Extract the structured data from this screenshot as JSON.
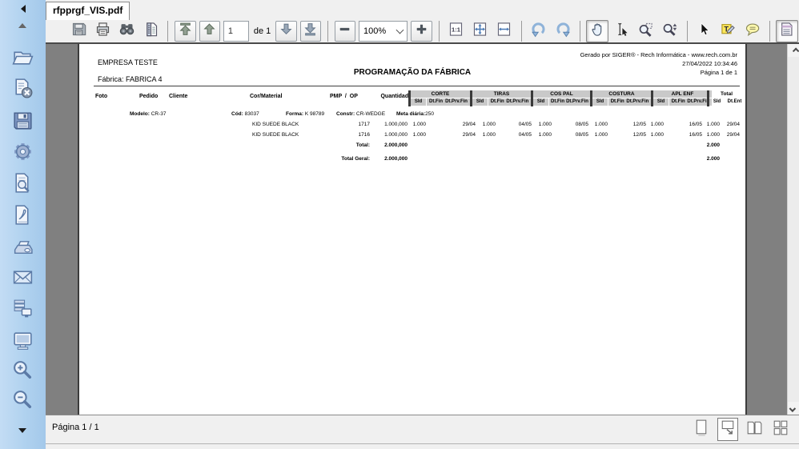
{
  "tab": {
    "title": "rfpprgf_VIS.pdf"
  },
  "toolbar": {
    "page_number": "1",
    "page_count_label": "de 1",
    "zoom_level": "100%",
    "actual_size_label": "1:1",
    "note_letter": "T"
  },
  "icons": {
    "sidebar": [
      "open-folder-icon",
      "close-document-icon",
      "save-icon",
      "settings-icon",
      "preview-icon",
      "pdf-icon",
      "print-icon",
      "email-icon",
      "export-icon",
      "monitor-icon",
      "zoom-in-icon",
      "zoom-out-icon"
    ],
    "toolbar": [
      "save-icon",
      "print-icon",
      "search-binoculars-icon",
      "report-icon",
      "first-page-icon",
      "prev-page-icon",
      "next-page-icon",
      "last-page-icon",
      "zoom-out-icon",
      "zoom-in-icon",
      "actual-size-icon",
      "fit-page-icon",
      "fit-width-icon",
      "rotate-left-icon",
      "rotate-right-icon",
      "hand-tool-icon",
      "select-text-icon",
      "zoom-marquee-icon",
      "zoom-dynamic-icon",
      "pointer-icon",
      "text-note-icon",
      "comment-icon",
      "pages-toggle-icon"
    ],
    "statusbar": [
      "single-page-icon",
      "fit-window-icon",
      "facing-pages-icon",
      "grid-pages-icon"
    ]
  },
  "report": {
    "company": "EMPRESA TESTE",
    "factory": "Fábrica: FABRICA 4",
    "title": "PROGRAMAÇÃO DA FÁBRICA",
    "generated_by": "Gerado por SIGER® - Rech Informática - www.rech.com.br",
    "generated_at": "27/04/2022 10:34:46",
    "page_info": "Página 1 de 1",
    "columns": {
      "foto": "Foto",
      "pedido": "Pedido",
      "cliente": "Cliente",
      "cor_material": "Cor/Material",
      "pmp_op": "PMP  /  OP",
      "quantidade": "Quantidade"
    },
    "groups": [
      {
        "name": "CORTE",
        "sld": "Sld",
        "fin": "Dt.Fin",
        "prv": "Dt.Prv.Fin"
      },
      {
        "name": "TIRAS",
        "sld": "Sld",
        "fin": "Dt.Fin",
        "prv": "Dt.Prv.Fin"
      },
      {
        "name": "COS PAL",
        "sld": "Sld",
        "fin": "Dt.Fin",
        "prv": "Dt.Prv.Fin"
      },
      {
        "name": "COSTURA",
        "sld": "Sld",
        "fin": "Dt.Fin",
        "prv": "Dt.Prv.Fin"
      },
      {
        "name": "APL ENF",
        "sld": "Sld",
        "fin": "Dt.Fin",
        "prv": "Dt.Prv.Fin"
      }
    ],
    "total_group": {
      "name": "Total",
      "sld": "Sld",
      "ent": "Dt.Ent"
    },
    "model": {
      "modelo_label": "Modelo:",
      "modelo": "CR-37",
      "cod_label": "Cód:",
      "cod": "83037",
      "forma_label": "Forma:",
      "forma": "K 98789",
      "constr_label": "Constr:",
      "constr": "CR-WEDGE",
      "meta_label": "Meta diária:",
      "meta": "250"
    },
    "rows": [
      {
        "cor": "KID SUEDE BLACK",
        "op": "1717",
        "qtd": "1.000,000",
        "corte_sld": "1.000",
        "corte_prv": "29/04",
        "tiras_sld": "1.000",
        "tiras_prv": "04/05",
        "cospal_sld": "1.000",
        "cospal_prv": "08/05",
        "costura_sld": "1.000",
        "costura_prv": "12/05",
        "aplenf_sld": "1.000",
        "aplenf_prv": "16/05",
        "total_sld": "1.000",
        "total_ent": "29/04"
      },
      {
        "cor": "KID SUEDE BLACK",
        "op": "1716",
        "qtd": "1.000,000",
        "corte_sld": "1.000",
        "corte_prv": "29/04",
        "tiras_sld": "1.000",
        "tiras_prv": "04/05",
        "cospal_sld": "1.000",
        "cospal_prv": "08/05",
        "costura_sld": "1.000",
        "costura_prv": "12/05",
        "aplenf_sld": "1.000",
        "aplenf_prv": "16/05",
        "total_sld": "1.000",
        "total_ent": "29/04"
      }
    ],
    "total_row": {
      "label": "Total:",
      "qtd": "2.000,000",
      "sld": "2.000"
    },
    "total_geral_row": {
      "label": "Total Geral:",
      "qtd": "2.000,000",
      "sld": "2.000"
    }
  },
  "statusbar": {
    "page_label": "Página 1 / 1"
  },
  "colors": {
    "sidebar_blue": "#b0d2ef",
    "chrome_gray": "#f0f0f0",
    "canvas_gray": "#808080",
    "header_cell_gray": "#c9c9c9",
    "accent_steel": "#5b7aa6"
  }
}
